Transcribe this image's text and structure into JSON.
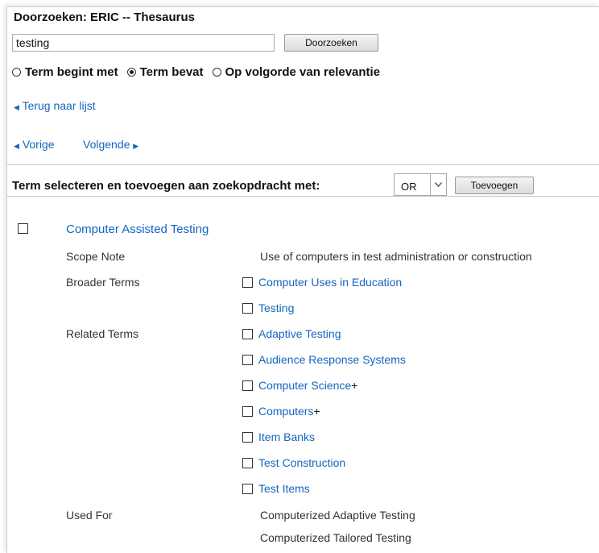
{
  "header": {
    "title": "Doorzoeken: ERIC -- Thesaurus"
  },
  "search": {
    "value": "testing",
    "button_label": "Doorzoeken"
  },
  "radio_options": [
    {
      "label": "Term begint met",
      "checked": false
    },
    {
      "label": "Term bevat",
      "checked": true
    },
    {
      "label": "Op volgorde van relevantie",
      "checked": false
    }
  ],
  "nav": {
    "back_label": "Terug naar lijst",
    "prev_label": "Vorige",
    "next_label": "Volgende"
  },
  "combine": {
    "label": "Term selecteren en toevoegen aan zoekopdracht met:",
    "operator": "OR",
    "add_label": "Toevoegen"
  },
  "entry": {
    "term": "Computer Assisted Testing",
    "scope_note_label": "Scope Note",
    "scope_note": "Use of computers in test administration or construction",
    "broader_label": "Broader Terms",
    "broader": [
      {
        "label": "Computer Uses in Education",
        "plus": ""
      },
      {
        "label": "Testing",
        "plus": ""
      }
    ],
    "related_label": "Related Terms",
    "related": [
      {
        "label": "Adaptive Testing",
        "plus": ""
      },
      {
        "label": "Audience Response Systems",
        "plus": ""
      },
      {
        "label": "Computer Science",
        "plus": "+"
      },
      {
        "label": "Computers",
        "plus": "+"
      },
      {
        "label": "Item Banks",
        "plus": ""
      },
      {
        "label": "Test Construction",
        "plus": ""
      },
      {
        "label": "Test Items",
        "plus": ""
      }
    ],
    "used_for_label": "Used For",
    "used_for": [
      "Computerized Adaptive Testing",
      "Computerized Tailored Testing"
    ]
  },
  "colors": {
    "link": "#1565c0",
    "text": "#222222"
  }
}
